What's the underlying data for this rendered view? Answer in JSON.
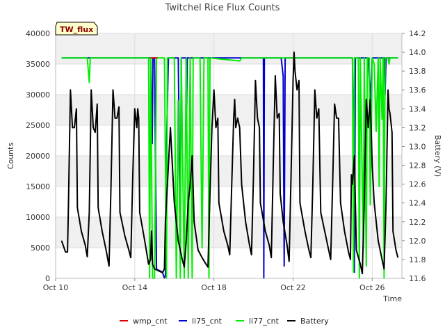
{
  "chart_data": {
    "type": "line",
    "title": "Twitchel Rice Flux Counts",
    "site_label": "TW_flux",
    "xlabel": "Time",
    "ylabel": "Counts",
    "y2label": "Battery (V)",
    "x_unit": "day of October",
    "xlim": [
      10,
      27.5
    ],
    "ylim": [
      0,
      40000
    ],
    "y2lim": [
      11.6,
      14.2
    ],
    "x_ticks": [
      {
        "value": 10,
        "label": "Oct 10"
      },
      {
        "value": 14,
        "label": "Oct 14"
      },
      {
        "value": 18,
        "label": "Oct 18"
      },
      {
        "value": 22,
        "label": "Oct 22"
      },
      {
        "value": 26,
        "label": "Oct 26"
      }
    ],
    "y_ticks": [
      0,
      5000,
      10000,
      15000,
      20000,
      25000,
      30000,
      35000,
      40000
    ],
    "y2_ticks": [
      "11.6",
      "11.8",
      "12.0",
      "12.2",
      "12.4",
      "12.6",
      "12.8",
      "13.0",
      "13.2",
      "13.4",
      "13.6",
      "13.8",
      "14.0",
      "14.2"
    ],
    "grid": true,
    "background_bands": true,
    "legend_position": "bottom",
    "series": [
      {
        "name": "wmp_cnt",
        "axis": "left",
        "color": "#dd0000",
        "points": [
          [
            14.8,
            36000
          ],
          [
            15.15,
            36000
          ]
        ]
      },
      {
        "name": "li75_cnt",
        "axis": "left",
        "color": "#0000cc",
        "points": [
          [
            10.3,
            36000
          ],
          [
            14.8,
            36000
          ],
          [
            14.88,
            22000
          ],
          [
            14.92,
            36000
          ],
          [
            15.0,
            36000
          ],
          [
            15.1,
            1500
          ],
          [
            15.4,
            1000
          ],
          [
            15.5,
            0
          ],
          [
            15.55,
            500
          ],
          [
            15.6,
            21000
          ],
          [
            15.7,
            36000
          ],
          [
            16.2,
            36000
          ],
          [
            16.3,
            5000
          ],
          [
            16.35,
            36000
          ],
          [
            16.6,
            36000
          ],
          [
            16.62,
            26000
          ],
          [
            16.65,
            36000
          ],
          [
            20.5,
            36000
          ],
          [
            20.52,
            0
          ],
          [
            20.55,
            36000
          ],
          [
            21.4,
            36000
          ],
          [
            21.5,
            33000
          ],
          [
            21.55,
            2000
          ],
          [
            21.6,
            36000
          ],
          [
            25.0,
            36000
          ],
          [
            25.1,
            1000
          ],
          [
            25.15,
            36000
          ],
          [
            25.8,
            36000
          ],
          [
            25.9,
            29000
          ],
          [
            26.0,
            36000
          ],
          [
            26.6,
            36000
          ],
          [
            26.65,
            30000
          ],
          [
            26.7,
            36000
          ],
          [
            27.3,
            36000
          ]
        ]
      },
      {
        "name": "li77_cnt",
        "axis": "left",
        "color": "#00ee00",
        "points": [
          [
            10.3,
            36000
          ],
          [
            11.6,
            36000
          ],
          [
            11.7,
            32000
          ],
          [
            11.75,
            36000
          ],
          [
            14.7,
            36000
          ],
          [
            14.75,
            0
          ],
          [
            14.8,
            36000
          ],
          [
            14.9,
            0
          ],
          [
            15.0,
            0
          ],
          [
            15.1,
            36000
          ],
          [
            15.5,
            36000
          ],
          [
            15.6,
            0
          ],
          [
            15.65,
            36000
          ],
          [
            16.0,
            36000
          ],
          [
            16.1,
            0
          ],
          [
            16.2,
            29000
          ],
          [
            16.3,
            0
          ],
          [
            16.35,
            36000
          ],
          [
            16.5,
            0
          ],
          [
            16.6,
            36000
          ],
          [
            16.7,
            0
          ],
          [
            16.8,
            36000
          ],
          [
            16.9,
            0
          ],
          [
            16.95,
            36000
          ],
          [
            17.1,
            36000
          ],
          [
            17.3,
            36000
          ],
          [
            17.4,
            5000
          ],
          [
            17.5,
            36000
          ],
          [
            17.7,
            36000
          ],
          [
            17.75,
            0
          ],
          [
            17.8,
            36000
          ],
          [
            19.3,
            35500
          ],
          [
            19.4,
            36000
          ],
          [
            25.0,
            36000
          ],
          [
            25.05,
            1000
          ],
          [
            25.1,
            36000
          ],
          [
            25.3,
            36000
          ],
          [
            25.35,
            0
          ],
          [
            25.4,
            36000
          ],
          [
            25.55,
            5000
          ],
          [
            25.6,
            36000
          ],
          [
            25.7,
            2000
          ],
          [
            25.75,
            36000
          ],
          [
            25.85,
            36000
          ],
          [
            25.9,
            12000
          ],
          [
            26.0,
            36000
          ],
          [
            26.1,
            35000
          ],
          [
            26.2,
            24000
          ],
          [
            26.3,
            36000
          ],
          [
            26.35,
            15000
          ],
          [
            26.4,
            36000
          ],
          [
            26.5,
            26000
          ],
          [
            26.55,
            36000
          ],
          [
            26.6,
            0
          ],
          [
            26.65,
            36000
          ],
          [
            26.8,
            36000
          ],
          [
            26.85,
            35000
          ],
          [
            26.9,
            36000
          ],
          [
            27.3,
            36000
          ]
        ]
      },
      {
        "name": "Battery",
        "axis": "right",
        "color": "#000000",
        "points": [
          [
            10.3,
            12.0
          ],
          [
            10.5,
            11.88
          ],
          [
            10.6,
            11.88
          ],
          [
            10.65,
            12.4
          ],
          [
            10.75,
            13.6
          ],
          [
            10.85,
            13.2
          ],
          [
            10.95,
            13.2
          ],
          [
            11.05,
            13.4
          ],
          [
            11.1,
            12.35
          ],
          [
            11.3,
            12.1
          ],
          [
            11.5,
            11.95
          ],
          [
            11.6,
            11.83
          ],
          [
            11.7,
            12.3
          ],
          [
            11.8,
            13.6
          ],
          [
            11.9,
            13.2
          ],
          [
            12.0,
            13.15
          ],
          [
            12.1,
            13.45
          ],
          [
            12.15,
            12.35
          ],
          [
            12.35,
            12.1
          ],
          [
            12.55,
            11.9
          ],
          [
            12.7,
            11.73
          ],
          [
            12.8,
            12.6
          ],
          [
            12.9,
            13.6
          ],
          [
            13.0,
            13.3
          ],
          [
            13.1,
            13.3
          ],
          [
            13.2,
            13.42
          ],
          [
            13.25,
            12.3
          ],
          [
            13.5,
            12.05
          ],
          [
            13.7,
            11.9
          ],
          [
            13.8,
            11.82
          ],
          [
            13.9,
            12.7
          ],
          [
            14.0,
            13.4
          ],
          [
            14.1,
            13.2
          ],
          [
            14.15,
            13.4
          ],
          [
            14.2,
            13.3
          ],
          [
            14.25,
            12.3
          ],
          [
            14.5,
            12.0
          ],
          [
            14.7,
            11.75
          ],
          [
            14.8,
            11.8
          ],
          [
            14.85,
            12.1
          ],
          [
            14.9,
            11.75
          ],
          [
            15.0,
            11.7
          ],
          [
            15.2,
            11.68
          ],
          [
            15.4,
            11.66
          ],
          [
            15.5,
            11.7
          ],
          [
            15.55,
            12.2
          ],
          [
            15.7,
            12.8
          ],
          [
            15.8,
            13.2
          ],
          [
            15.9,
            12.8
          ],
          [
            16.0,
            12.4
          ],
          [
            16.2,
            12.0
          ],
          [
            16.4,
            11.8
          ],
          [
            16.5,
            11.72
          ],
          [
            16.6,
            12.0
          ],
          [
            16.7,
            12.4
          ],
          [
            16.8,
            12.6
          ],
          [
            16.9,
            12.9
          ],
          [
            17.0,
            12.2
          ],
          [
            17.2,
            11.9
          ],
          [
            17.4,
            11.82
          ],
          [
            17.6,
            11.75
          ],
          [
            17.7,
            11.72
          ],
          [
            17.8,
            12.5
          ],
          [
            17.9,
            13.2
          ],
          [
            18.0,
            13.6
          ],
          [
            18.1,
            13.2
          ],
          [
            18.2,
            13.3
          ],
          [
            18.25,
            12.4
          ],
          [
            18.5,
            12.1
          ],
          [
            18.7,
            11.95
          ],
          [
            18.8,
            11.85
          ],
          [
            18.9,
            12.6
          ],
          [
            19.0,
            13.3
          ],
          [
            19.05,
            13.5
          ],
          [
            19.1,
            13.2
          ],
          [
            19.2,
            13.3
          ],
          [
            19.3,
            13.2
          ],
          [
            19.4,
            12.6
          ],
          [
            19.6,
            12.2
          ],
          [
            19.8,
            11.95
          ],
          [
            19.9,
            11.85
          ],
          [
            20.0,
            12.7
          ],
          [
            20.1,
            13.7
          ],
          [
            20.2,
            13.3
          ],
          [
            20.3,
            13.2
          ],
          [
            20.35,
            12.4
          ],
          [
            20.6,
            12.1
          ],
          [
            20.8,
            11.95
          ],
          [
            20.9,
            11.82
          ],
          [
            21.0,
            12.8
          ],
          [
            21.1,
            13.75
          ],
          [
            21.2,
            13.3
          ],
          [
            21.3,
            13.35
          ],
          [
            21.35,
            12.5
          ],
          [
            21.5,
            12.2
          ],
          [
            21.7,
            11.95
          ],
          [
            21.8,
            11.78
          ],
          [
            21.9,
            12.7
          ],
          [
            22.0,
            13.7
          ],
          [
            22.05,
            14.0
          ],
          [
            22.1,
            13.8
          ],
          [
            22.2,
            13.6
          ],
          [
            22.3,
            13.7
          ],
          [
            22.35,
            12.4
          ],
          [
            22.6,
            12.1
          ],
          [
            22.8,
            11.9
          ],
          [
            22.9,
            11.82
          ],
          [
            23.0,
            12.6
          ],
          [
            23.1,
            13.6
          ],
          [
            23.2,
            13.3
          ],
          [
            23.3,
            13.4
          ],
          [
            23.4,
            12.3
          ],
          [
            23.6,
            12.1
          ],
          [
            23.8,
            11.9
          ],
          [
            23.9,
            11.8
          ],
          [
            24.0,
            12.6
          ],
          [
            24.1,
            13.45
          ],
          [
            24.2,
            13.3
          ],
          [
            24.3,
            13.3
          ],
          [
            24.4,
            12.4
          ],
          [
            24.6,
            12.1
          ],
          [
            24.8,
            11.88
          ],
          [
            24.9,
            11.8
          ],
          [
            24.95,
            12.7
          ],
          [
            25.0,
            12.6
          ],
          [
            25.1,
            12.9
          ],
          [
            25.2,
            11.9
          ],
          [
            25.4,
            11.75
          ],
          [
            25.5,
            11.65
          ],
          [
            25.6,
            12.4
          ],
          [
            25.7,
            13.5
          ],
          [
            25.8,
            13.2
          ],
          [
            25.9,
            13.5
          ],
          [
            26.0,
            12.8
          ],
          [
            26.1,
            12.4
          ],
          [
            26.3,
            12.0
          ],
          [
            26.5,
            11.8
          ],
          [
            26.6,
            11.7
          ],
          [
            26.7,
            12.4
          ],
          [
            26.8,
            13.6
          ],
          [
            26.85,
            13.4
          ],
          [
            26.9,
            13.35
          ],
          [
            27.0,
            13.15
          ],
          [
            27.05,
            12.1
          ],
          [
            27.2,
            11.9
          ],
          [
            27.3,
            11.82
          ]
        ]
      }
    ]
  }
}
